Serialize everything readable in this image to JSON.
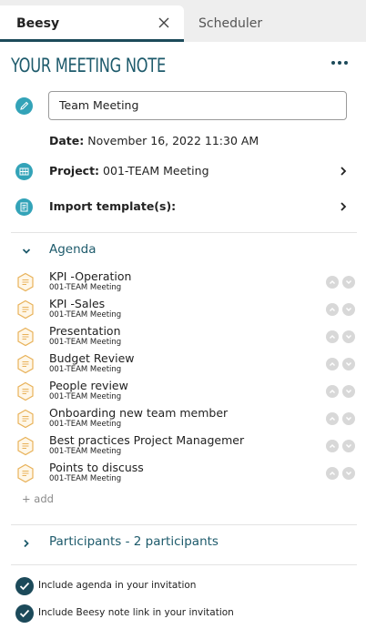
{
  "tabs": {
    "active": "Beesy",
    "inactive": "Scheduler"
  },
  "header": {
    "title": "YOUR MEETING NOTE"
  },
  "meeting": {
    "name": "Team Meeting",
    "date_label": "Date:",
    "date_value": "November 16, 2022 11:30 AM",
    "project_label": "Project:",
    "project_value": "001-TEAM Meeting",
    "import_label": "Import template(s):"
  },
  "agenda": {
    "title": "Agenda",
    "items": [
      {
        "title": "KPI -Operation",
        "project": "001-TEAM Meeting"
      },
      {
        "title": "KPI -Sales",
        "project": "001-TEAM Meeting"
      },
      {
        "title": "Presentation",
        "project": "001-TEAM Meeting"
      },
      {
        "title": "Budget Review",
        "project": "001-TEAM Meeting"
      },
      {
        "title": "People review",
        "project": "001-TEAM Meeting"
      },
      {
        "title": "Onboarding new team member",
        "project": "001-TEAM Meeting"
      },
      {
        "title": "Best practices Project Managemer",
        "project": "001-TEAM Meeting"
      },
      {
        "title": "Points to discuss",
        "project": "001-TEAM Meeting"
      }
    ],
    "add_label": "+ add"
  },
  "participants": {
    "title": "Participants - 2 participants"
  },
  "options": {
    "include_agenda": "Include agenda in your invitation",
    "include_link": "Include Beesy note link in your invitation"
  },
  "colors": {
    "accent": "#1d5a6b",
    "icon_teal": "#33a3b8",
    "hex_orange": "#e8b25a",
    "check_dark": "#1c4a5a"
  }
}
